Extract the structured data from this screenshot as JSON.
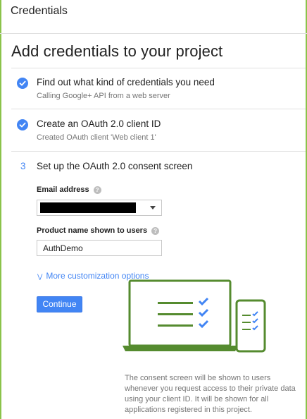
{
  "window": {
    "title": "Credentials"
  },
  "page": {
    "heading": "Add credentials to your project"
  },
  "steps": [
    {
      "title": "Find out what kind of credentials you need",
      "subtitle": "Calling Google+ API from a web server",
      "status": "done"
    },
    {
      "title": "Create an OAuth 2.0 client ID",
      "subtitle": "Created OAuth client 'Web client 1'",
      "status": "done"
    },
    {
      "number": "3",
      "title": "Set up the OAuth 2.0 consent screen",
      "status": "active"
    }
  ],
  "form": {
    "email_label": "Email address",
    "email_value_redacted": true,
    "product_label": "Product name shown to users",
    "product_value": "AuthDemo",
    "more_options": "More customization options",
    "continue_label": "Continue",
    "help_glyph": "?"
  },
  "consent_note": "The consent screen will be shown to users whenever you request access to their private data using your client ID. It will be shown for all applications registered in this project.",
  "colors": {
    "accent": "#4285f4",
    "illustration": "#558b2f",
    "frame": "#8bc34a"
  },
  "icons": [
    "check-circle-icon",
    "help-icon",
    "chevron-down-icon",
    "dropdown-caret-icon",
    "laptop-illustration",
    "phone-illustration"
  ]
}
